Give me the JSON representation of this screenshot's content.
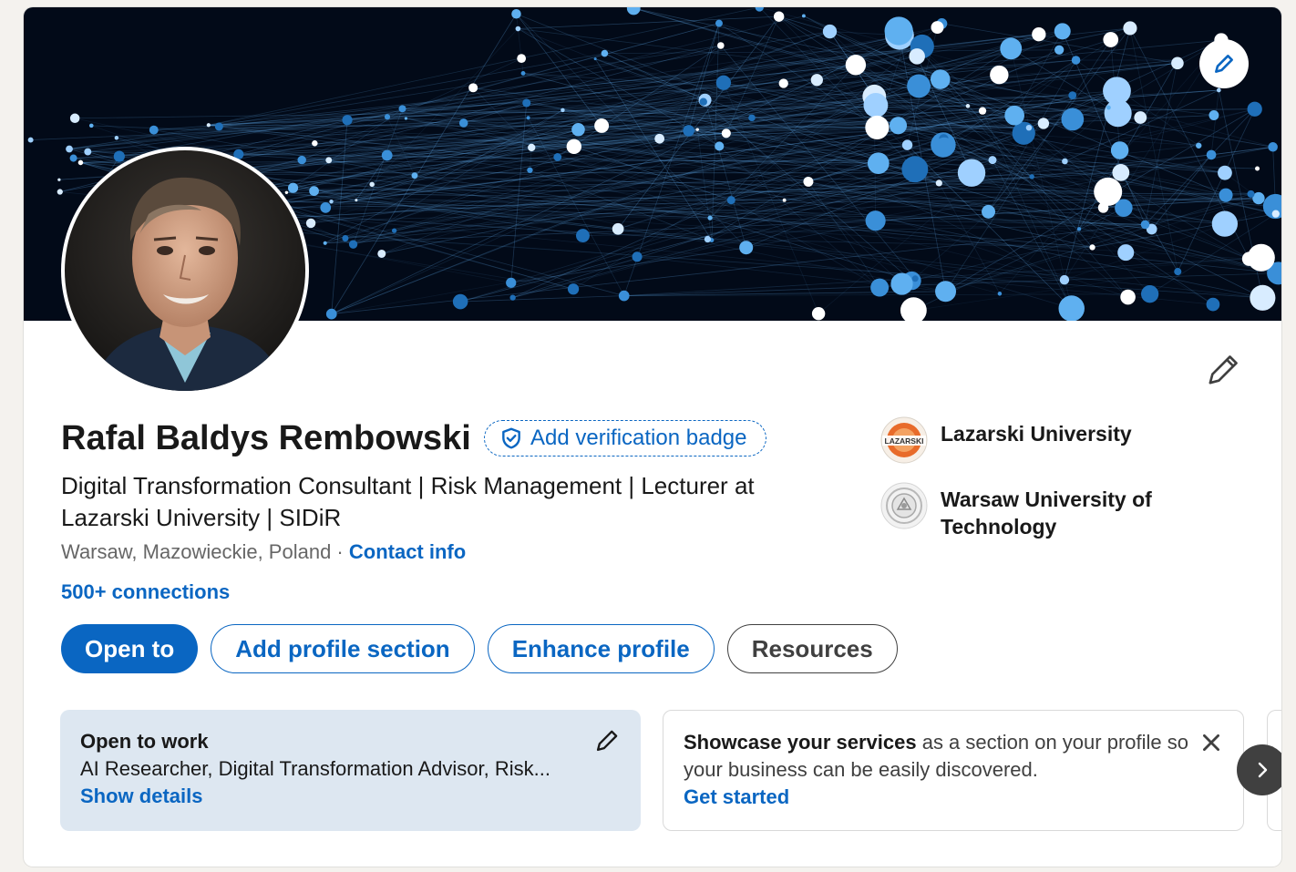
{
  "profile": {
    "name": "Rafal Baldys Rembowski",
    "verification_badge": "Add verification badge",
    "headline": "Digital Transformation Consultant | Risk Management | Lecturer at Lazarski University | SIDiR",
    "location": "Warsaw, Mazowieckie, Poland",
    "separator": " · ",
    "contact_info": "Contact info",
    "connections": "500+ connections"
  },
  "actions": {
    "open_to": "Open to",
    "add_profile_section": "Add profile section",
    "enhance_profile": "Enhance profile",
    "resources": "Resources"
  },
  "education": [
    {
      "name": "Lazarski University",
      "logo_text": "LAZARSKI"
    },
    {
      "name": "Warsaw University of Technology"
    }
  ],
  "open_to_work": {
    "title": "Open to work",
    "roles": "AI Researcher, Digital Transformation Advisor, Risk...",
    "link": "Show details"
  },
  "services": {
    "bold": "Showcase your services",
    "text": " as a section on your profile so your business can be easily discovered.",
    "link": "Get started"
  },
  "icons": {
    "banner_edit": "pencil-icon",
    "intro_edit": "pencil-icon",
    "verification": "shield-check-icon",
    "close": "close-icon",
    "next": "chevron-right-icon"
  },
  "colors": {
    "accent": "#0a66c2",
    "open_to_work_bg": "#dde7f1",
    "banner_bg": "#020a18",
    "node_blue": "#3a8fd8"
  }
}
